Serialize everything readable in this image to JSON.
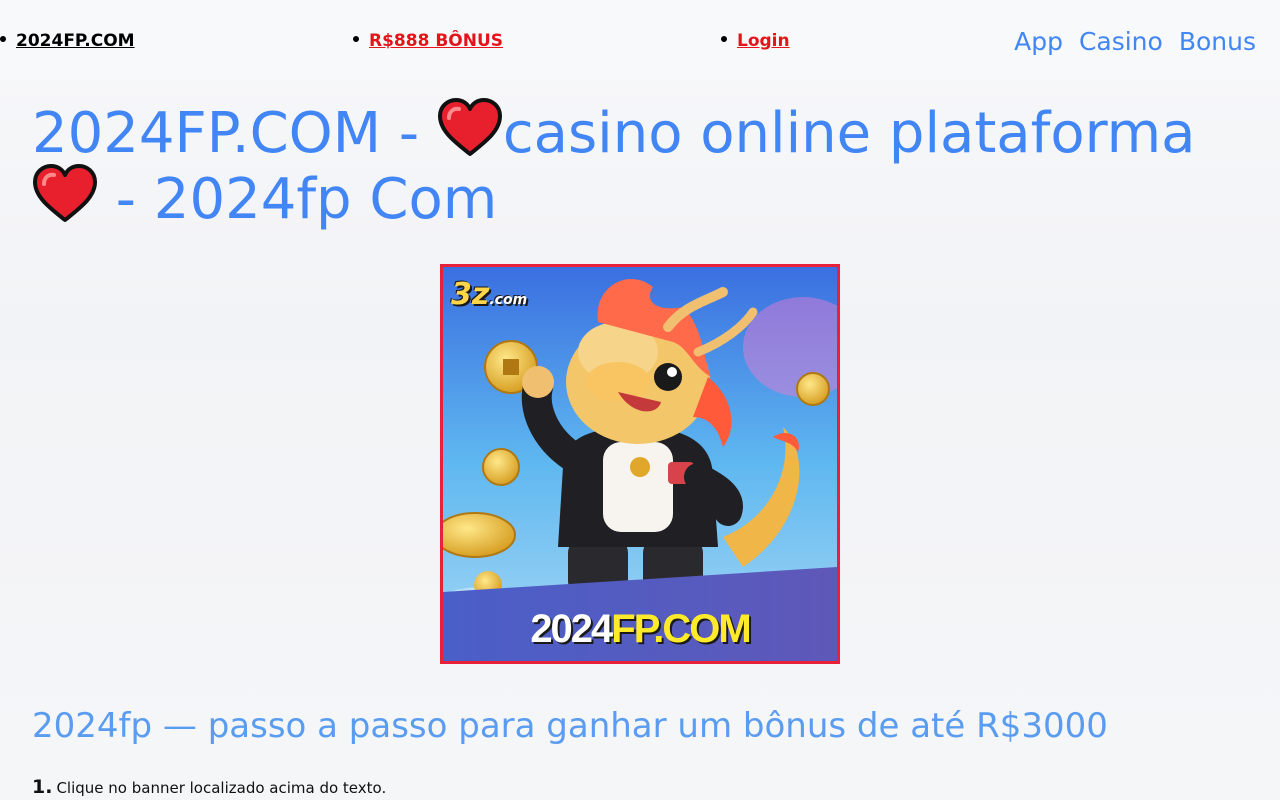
{
  "nav": {
    "home_label": "2024FP.COM",
    "bonus_label": "R$888 BÔNUS",
    "login_label": "Login",
    "menu": [
      "App",
      "Casino",
      "Bonus"
    ]
  },
  "title": {
    "part1": "2024FP.COM - ",
    "part2": "casino online plataforma",
    "part3": " - 2024fp Com"
  },
  "banner": {
    "logo_text": "3z",
    "logo_suffix": ".com",
    "caption_white": "2024",
    "caption_yellow": "FP.COM"
  },
  "subtitle": "2024fp — passo a passo para ganhar um bônus de até R$3000",
  "steps": [
    {
      "num": "1.",
      "text": "Clique no banner localizado acima do texto."
    }
  ],
  "colors": {
    "accent": "#4285f4",
    "link_red": "#e5141b",
    "heart": "#e8202e"
  }
}
